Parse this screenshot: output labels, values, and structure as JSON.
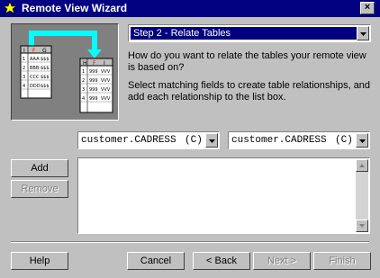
{
  "window": {
    "title": "Remote View Wizard",
    "close_glyph": "×"
  },
  "step_select": {
    "value": "Step 2 - Relate Tables"
  },
  "instructions": {
    "question": "How do you want to relate the tables your remote view is based on?",
    "hint": "Select matching fields to create table relationships, and add each relationship to the list box."
  },
  "field_left": {
    "value": "customer.CADRESS",
    "suffix": "(C)"
  },
  "field_right": {
    "value": "customer.CADRESS",
    "suffix": "(C)"
  },
  "buttons": {
    "add": "Add",
    "remove": "Remove",
    "help": "Help",
    "cancel": "Cancel",
    "back": "< Back",
    "next": "Next >",
    "finish": "Finish"
  },
  "relationships": [],
  "illustration": {
    "left_table": {
      "headers": [
        "I",
        "F",
        "G"
      ],
      "rows": [
        [
          "1",
          "AAA",
          "$$$"
        ],
        [
          "2",
          "BBB",
          "$$$"
        ],
        [
          "3",
          "CCC",
          "$$$"
        ],
        [
          "4",
          "DDD",
          "$$$"
        ]
      ]
    },
    "right_table": {
      "headers": [
        "H",
        "F",
        "I"
      ],
      "rows": [
        [
          "1",
          "999",
          "VVV"
        ],
        [
          "2",
          "999",
          "VVV"
        ],
        [
          "3",
          "999",
          "VVV"
        ],
        [
          "4",
          "999",
          "VVV"
        ]
      ]
    },
    "link_color": "#00ffff",
    "key_color": "#ff0000"
  },
  "colors": {
    "titlebar": "#000080",
    "face": "#c0c0c0",
    "selection": "#000080"
  }
}
